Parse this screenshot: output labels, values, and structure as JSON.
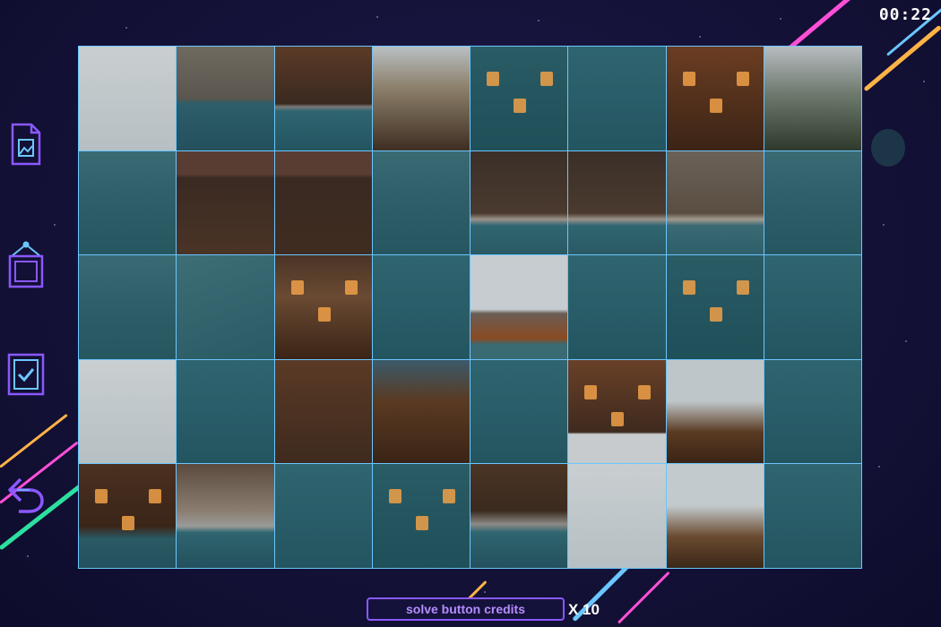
{
  "timer": "00:22",
  "colors": {
    "accent_blue": "#6bc6ff",
    "accent_purple": "#8a58ff",
    "accent_pink": "#ff4fd8",
    "accent_orange": "#ffb347",
    "accent_green": "#2de0a0"
  },
  "sidebar": {
    "items": [
      {
        "name": "image-preview",
        "icon": "image-file-icon"
      },
      {
        "name": "frame",
        "icon": "picture-frame-icon"
      },
      {
        "name": "check",
        "icon": "checkbox-icon"
      },
      {
        "name": "undo",
        "icon": "undo-arrow-icon"
      }
    ]
  },
  "board": {
    "columns": 8,
    "rows": 5,
    "tiles": [
      "sky",
      "pool-stone-wall",
      "pool-gate",
      "railing-deck",
      "reflection-lights",
      "reflection",
      "house-facade-lit",
      "pine-deck",
      "reflection-roof",
      "house-roof",
      "house-roof-right",
      "reflection-roof",
      "pool-chairs",
      "pool-chairs",
      "deck-chairs",
      "reflection-roof",
      "reflection-roof",
      "reflection-beam",
      "umbrella-deck",
      "reflection",
      "roof-gable",
      "reflection",
      "reflection-lights",
      "reflection",
      "sky",
      "reflection",
      "cabin-stone",
      "timber-gable",
      "reflection",
      "house-windows",
      "sky-roof",
      "reflection",
      "house-lower",
      "rocks-pool",
      "reflection",
      "reflection-lights",
      "pool-steps",
      "sky",
      "sky-timber",
      "reflection"
    ]
  },
  "footer": {
    "credits_label": "solve button credits",
    "multiplier": "X 10"
  }
}
